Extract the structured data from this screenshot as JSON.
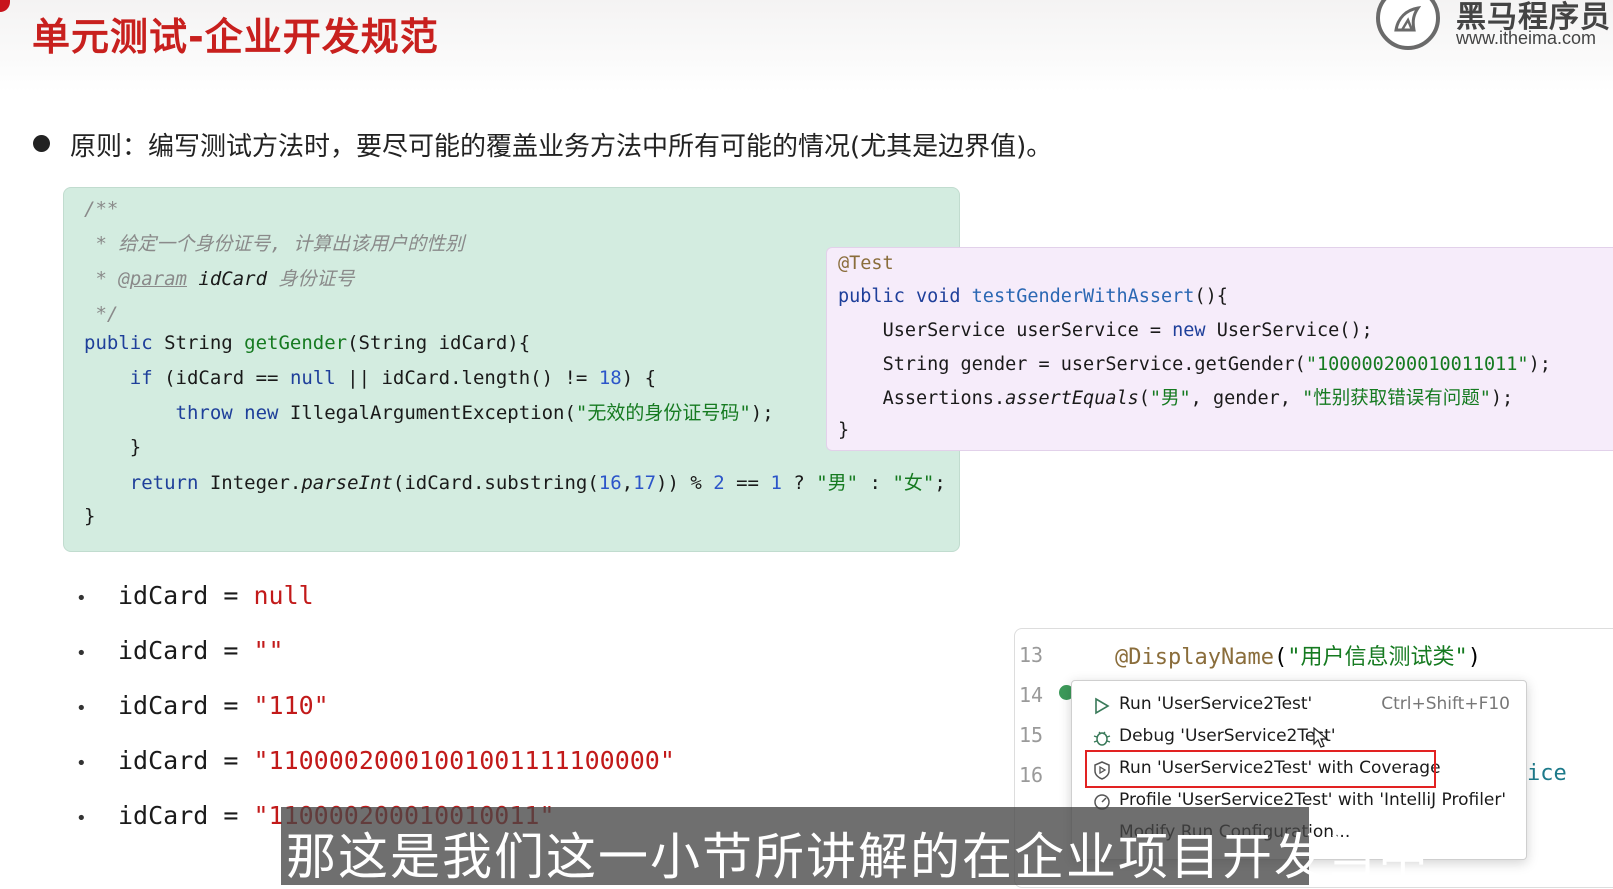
{
  "slide": {
    "title": "单元测试-企业开发规范"
  },
  "logo": {
    "brand": "黑马程序员",
    "url": "www.itheima.com"
  },
  "principle": {
    "text": "原则：编写测试方法时，要尽可能的覆盖业务方法中所有可能的情况(尤其是边界值)。"
  },
  "main_code": {
    "comment_open": "/**",
    "comment_desc": " * 给定一个身份证号, 计算出该用户的性别",
    "comment_param_prefix": " * ",
    "comment_param_tag": "@param",
    "comment_param_name": " idCard ",
    "comment_param_desc": "身份证号",
    "comment_close": " */",
    "sig_public": "public",
    "sig_rest_1": " String ",
    "sig_method": "getGender",
    "sig_rest_2": "(String idCard){",
    "if_indent": "    ",
    "if_kw": "if",
    "if_mid_1": " (idCard == ",
    "if_null": "null",
    "if_mid_2": " || idCard.length() != ",
    "if_num": "18",
    "if_end": ") {",
    "throw_indent": "        ",
    "throw_kw": "throw",
    "throw_new": " new",
    "throw_cls": " IllegalArgumentException(",
    "throw_msg": "\"无效的身份证号码\"",
    "throw_end": ");",
    "close_if": "    }",
    "ret_indent": "    ",
    "ret_kw": "return",
    "ret_cls": " Integer.",
    "ret_method": "parseInt",
    "ret_mid_1": "(idCard.substring(",
    "ret_n1": "16",
    "ret_comma": ",",
    "ret_n2": "17",
    "ret_mid_2": ")) % ",
    "ret_n3": "2",
    "ret_eq": " == ",
    "ret_n4": "1",
    "ret_q": " ? ",
    "ret_male": "\"男\"",
    "ret_colon": " : ",
    "ret_female": "\"女\"",
    "ret_end": ";",
    "close_method": "}"
  },
  "test_code": {
    "annotation": "@Test",
    "sig_public": "public",
    "sig_void": " void",
    "sig_method": " testGenderWithAssert",
    "sig_end": "(){",
    "l1_indent": "    ",
    "l1_a": "UserService userService = ",
    "l1_new": "new",
    "l1_b": " UserService();",
    "l2_indent": "    ",
    "l2_a": "String gender = userService.getGender(",
    "l2_str": "\"100000200010011011\"",
    "l2_end": ");",
    "l3_indent": "    ",
    "l3_a": "Assertions.",
    "l3_method": "assertEquals",
    "l3_b": "(",
    "l3_s1": "\"男\"",
    "l3_c": ", gender, ",
    "l3_s2": "\"性别获取错误有问题\"",
    "l3_end": ");",
    "close": "}"
  },
  "cases": [
    {
      "bullet": "•",
      "label": "idCard = ",
      "value": "null"
    },
    {
      "bullet": "•",
      "label": "idCard = ",
      "value": "\"\""
    },
    {
      "bullet": "•",
      "label": "idCard = ",
      "value": "\"110\""
    },
    {
      "bullet": "•",
      "label": "idCard = ",
      "value": "\"11000020001001001111100000\""
    },
    {
      "bullet": "•",
      "label": "idCard = ",
      "value": "\"110000200010010011\""
    }
  ],
  "ide": {
    "lines": [
      "13",
      "14",
      "15",
      "16"
    ],
    "annotation": "@DisplayName",
    "annotation_open": "(",
    "annotation_arg": "\"用户信息测试类\"",
    "annotation_close": ")",
    "tail_text": "ice"
  },
  "context_menu": {
    "items": [
      {
        "label": "Run 'UserService2Test'",
        "shortcut": "Ctrl+Shift+F10",
        "icon": "run-icon"
      },
      {
        "label": "Debug 'UserService2Test'",
        "shortcut": "",
        "icon": "debug-icon"
      },
      {
        "label": "Run 'UserService2Test' with Coverage",
        "shortcut": "",
        "icon": "coverage-icon"
      },
      {
        "label": "Profile 'UserService2Test' with 'IntelliJ Profiler'",
        "shortcut": "",
        "icon": "profiler-icon"
      },
      {
        "label": "Modify Run Configuration...",
        "shortcut": "",
        "icon": ""
      }
    ]
  },
  "subtitle": {
    "text": "那这是我们这一小节所讲解的在企业项目开发当中"
  },
  "colors": {
    "title_red": "#c8201e",
    "main_code_bg": "#d3ece0",
    "test_code_bg": "#f6ecfa",
    "highlight_red": "#e22222",
    "literal_red": "#c21a1a"
  }
}
